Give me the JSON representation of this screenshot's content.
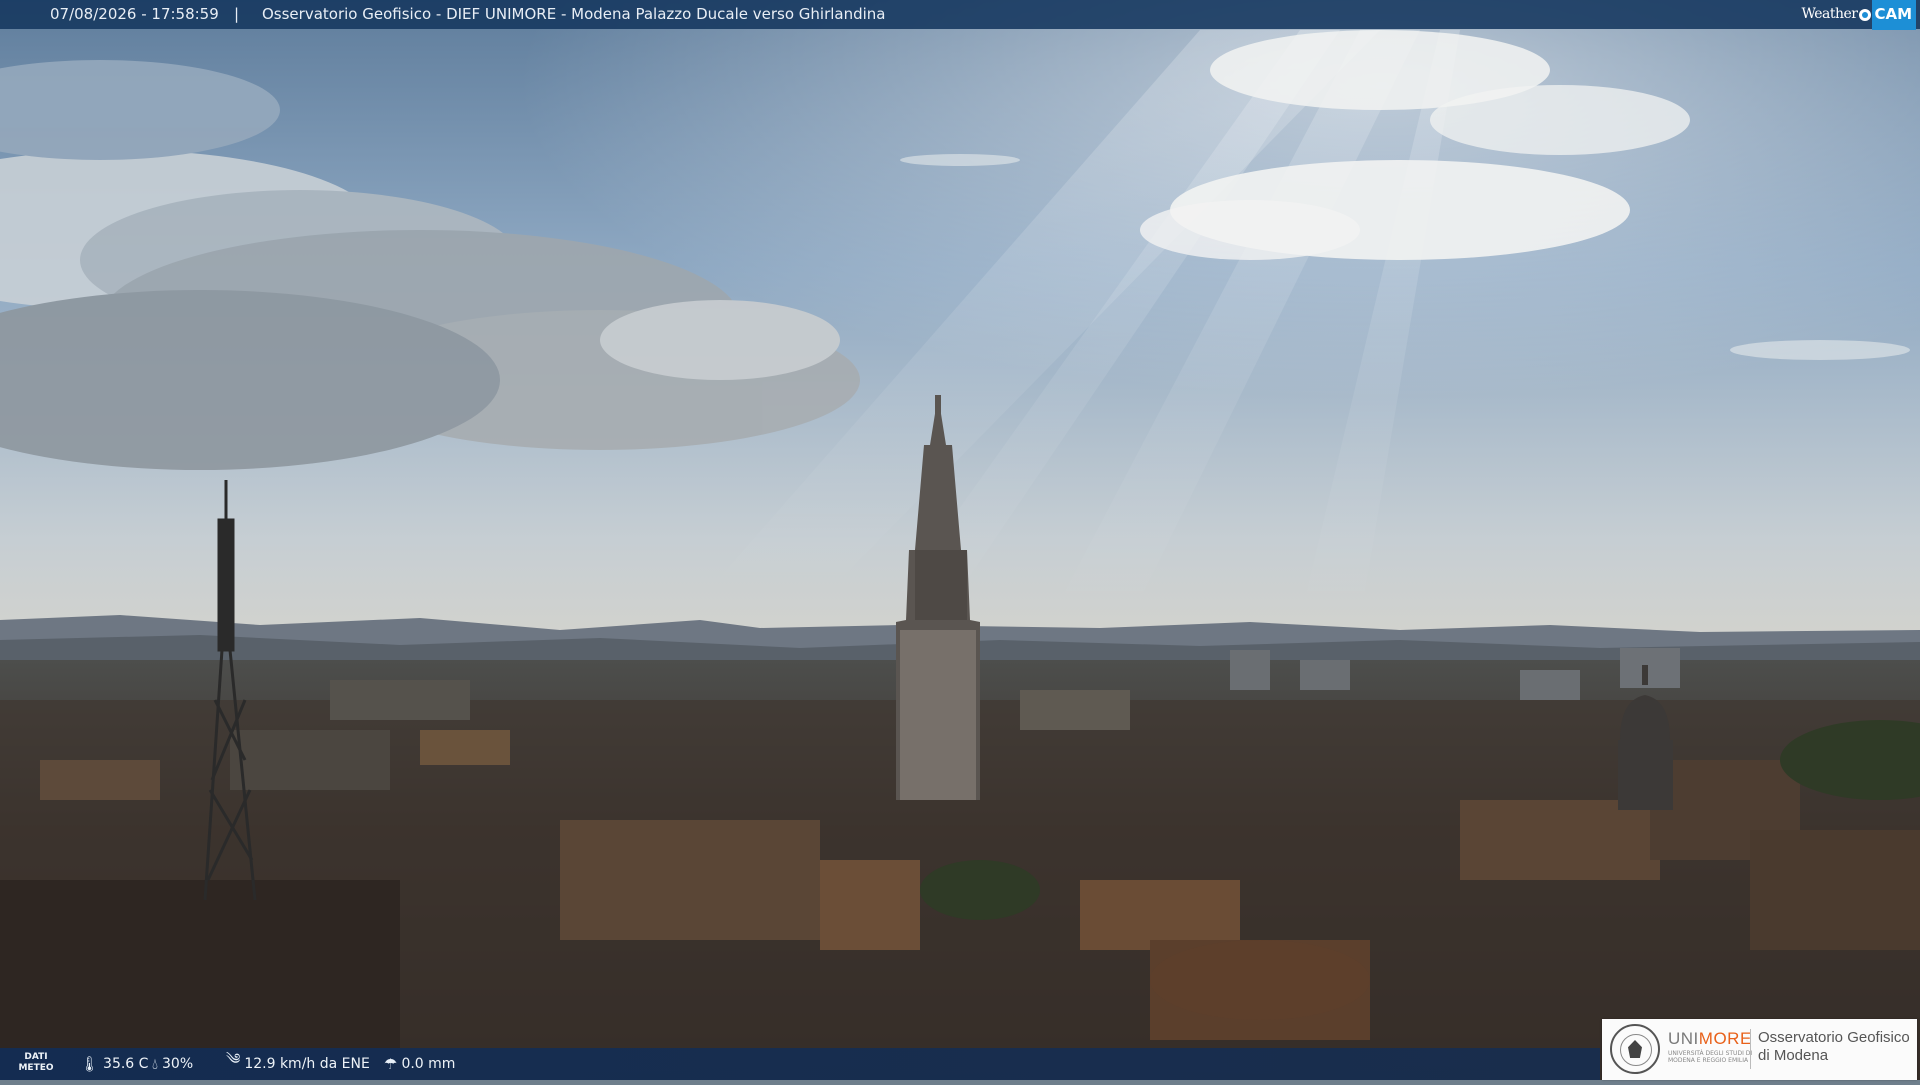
{
  "header": {
    "timestamp": "07/08/2026 - 17:58:59",
    "separator": "|",
    "title": "Osservatorio Geofisico - DIEF UNIMORE - Modena Palazzo Ducale verso Ghirlandina",
    "brand_weather": "Weather",
    "brand_cam": "CAM"
  },
  "weather": {
    "label_line1": "DATI",
    "label_line2": "METEO",
    "temperature": "35.6 C",
    "humidity": "30%",
    "wind": "12.9 km/h da ENE",
    "rain": "0.0 mm",
    "icons": [
      "thermometer-icon",
      "humidity-drop-icon",
      "wind-icon",
      "rain-gauge-icon"
    ]
  },
  "logo": {
    "uni_prefix": "UNI",
    "uni_suffix": "MORE",
    "uni_subtitle": "UNIVERSITÀ DEGLI STUDI DI MODENA E REGGIO EMILIA",
    "observatory_line1": "Osservatorio Geofisico",
    "observatory_line2": "di Modena"
  },
  "colors": {
    "bar_bg": "#143760",
    "brand_accent": "#1d8fd6",
    "unimore_orange": "#e8611a"
  }
}
